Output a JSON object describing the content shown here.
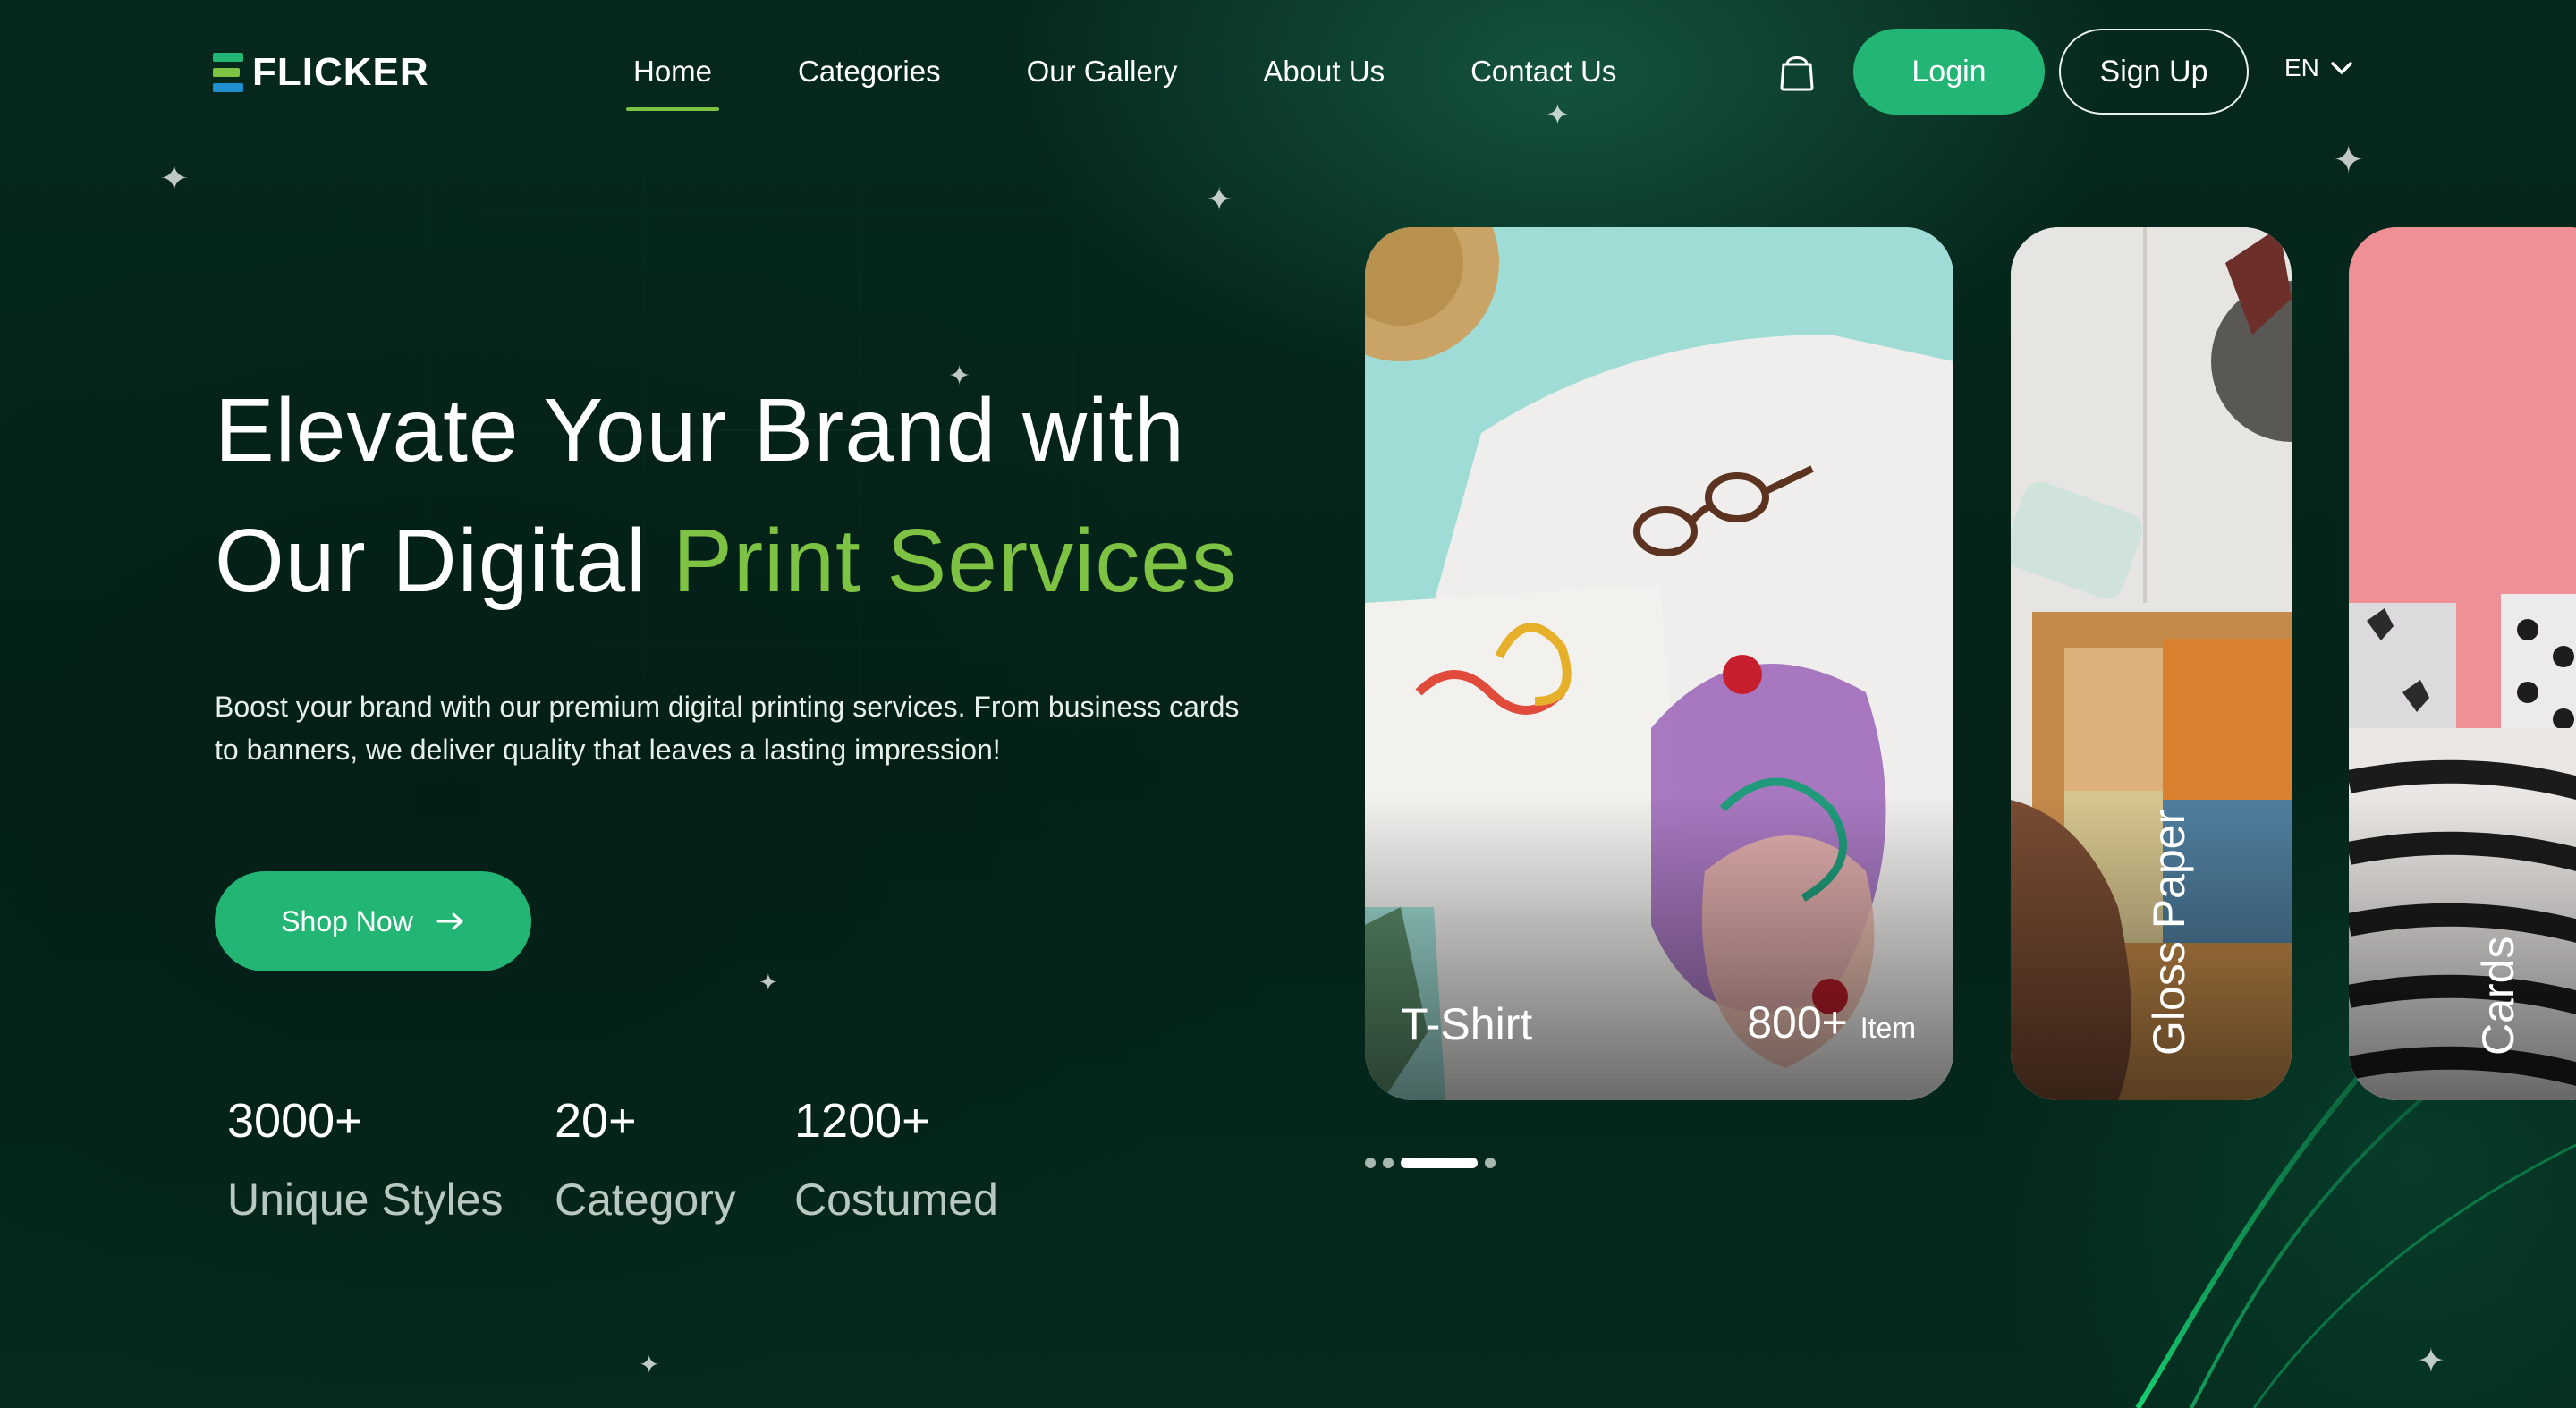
{
  "brand": {
    "logo_text": "FLICKER",
    "colors": {
      "primary_green": "#22b574",
      "accent_lime": "#7dc242",
      "background": "#062a1f"
    }
  },
  "nav": {
    "items": [
      {
        "label": "Home",
        "active": true
      },
      {
        "label": "Categories",
        "active": false
      },
      {
        "label": "Our Gallery",
        "active": false
      },
      {
        "label": "About Us",
        "active": false
      },
      {
        "label": "Contact Us",
        "active": false
      }
    ],
    "cart_icon": "shopping-bag-icon",
    "login_label": "Login",
    "signup_label": "Sign Up",
    "language": "EN"
  },
  "hero": {
    "title_line1": "Elevate Your Brand with",
    "title_line2_plain": "Our Digital ",
    "title_line2_accent": "Print Services",
    "description": "Boost your brand with our premium digital printing services. From business cards to banners, we deliver quality that leaves a lasting impression!",
    "cta_label": "Shop Now"
  },
  "stats": [
    {
      "value": "3000+",
      "label": "Unique Styles"
    },
    {
      "value": "20+",
      "label": "Category"
    },
    {
      "value": "1200+",
      "label": "Costumed"
    }
  ],
  "carousel": {
    "cards": [
      {
        "title": "T-Shirt",
        "count": "800+",
        "count_unit": "Item"
      },
      {
        "title": "Gloss Paper"
      },
      {
        "title": "Cards"
      }
    ],
    "dots_count": 4,
    "active_dot": 2
  }
}
